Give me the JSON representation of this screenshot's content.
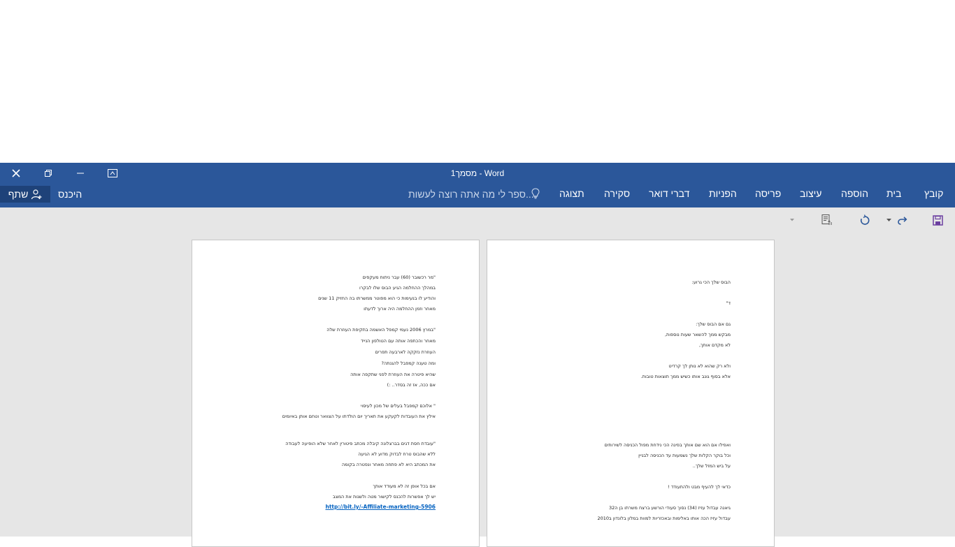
{
  "window": {
    "title": "מסמך1 - Word"
  },
  "ribbon": {
    "tabs": [
      "קובץ",
      "בית",
      "הוספה",
      "עיצוב",
      "פריסה",
      "הפניות",
      "דברי דואר",
      "סקירה",
      "תצוגה"
    ],
    "tell_me_placeholder": "ספר לי מה אתה רוצה לעשות...",
    "sign_in": "היכנס",
    "share": "שתף"
  },
  "colors": {
    "ribbon_blue": "#2b579a",
    "workspace_gray": "#e6e6e6",
    "link_blue": "#0563c1"
  },
  "icons": {
    "close": "close-icon",
    "restore": "restore-icon",
    "minimize": "minimize-icon",
    "ribbon_display": "ribbon-display-options-icon",
    "save": "save-icon",
    "undo": "undo-icon",
    "redo": "redo-icon",
    "touch_mode": "touch-mode-icon",
    "lightbulb": "lightbulb-icon",
    "user_add": "user-add-icon"
  },
  "pages": {
    "page1_lines": [
      "הבוס שלך הכי גרוע:",
      "ד\"",
      "גם אם הבוס שלך:",
      "מבקש ממך להשאר שעות נוספות,",
      "לא מקדם אותך,",
      "ולא רק שהוא לא נותן לך קרדיט",
      "אלא בסוף גונב אותו כשיש ממך תוצאות טובות.",
      "ואפילו אם הוא שם אותך בפינה הכי נידחת מפול הכניסה לשירותים",
      "וכל בוקר הקלות שלך נשמעות עד הכניסה לבניין",
      " על ביש המזל שלך..",
      "כדאי לך להעיף מבט ולהתעודד !",
      "גיאנה עבדול עזיז (34) נסוך סעודי הורשע ברצח משרתו בן ה32",
      "עבדול עזיז הכה אותו באלימות ובאכזריות למוות במלון בלונדון ב2010"
    ],
    "page2_lines": [
      "\"מר רכשובר (60) עבר ניתוח מעקפים",
      "במהלך ההחלמה הגיע הבוס שלו  לבקרו",
      "והודיע לו בנעימות כי הוא מפוטר ממשרתו בה החזיק 11 שנים",
      "מאחר וזמן ההחלמה היה ארוך לדעתו",
      "\"במרץ 2006 נעמי קמפל האשמה בתקיפת העוזרת שלה",
      "מאחר והכתפה אותה עם הטולפון הנייד",
      "העוזרת נזקקה לארבעה תפרים",
      "ומה טענה קמפבל להגנתה?",
      "שהיא פיטרה את העוזרת לפני שתקפה אותה",
      "אם ככה, אז זה בסדר.. :)",
      "\" אלוכם קמפבל בעלים של מכון לעיסוי",
      "אילץ את העובדות לקעקע את תאריך יום הולדתו על הצוואר וטחם אותן באיומים",
      "\"עובדת חסת דגים בברצלונה קיבלה מכתב פיטורין לאחר שלא הופיעה לעבודה",
      "ללא שהבוס טרח לבדוק מדוע לא הגיעה",
      "את המכתב היא לא פתחה מאחר ונפטרה בקומה",
      " אם בכל אופן זה לא מעודד אותך",
      "יש לך אפשרות להכנס לקישור מטה ולשנות את המצב"
    ],
    "page2_link": "http://bit.ly/-Affiliate-marketing-5906"
  }
}
